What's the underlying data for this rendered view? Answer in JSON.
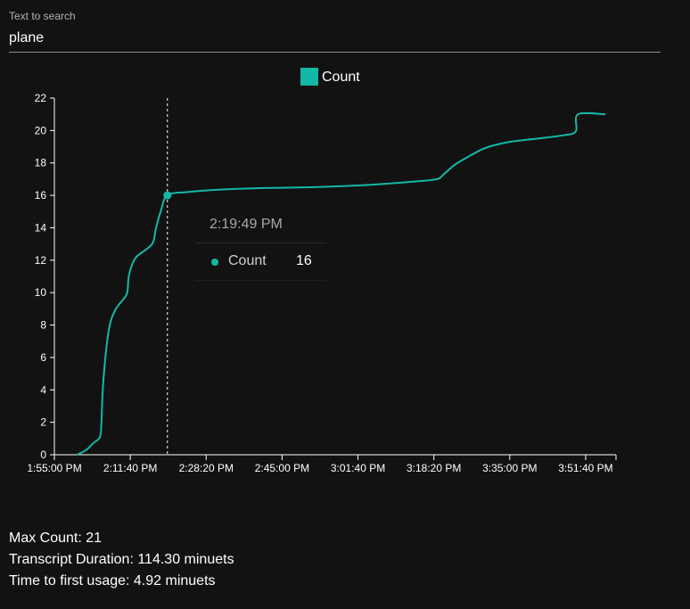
{
  "search": {
    "label": "Text to search",
    "value": "plane"
  },
  "colors": {
    "series": "#14b8a6",
    "background": "#121212",
    "text": "#ffffff",
    "muted": "#a8a8a8"
  },
  "tooltip": {
    "time": "2:19:49 PM",
    "series_name": "Count",
    "value": "16"
  },
  "stats": {
    "max_count": "Max Count: 21",
    "duration": "Transcript Duration: 114.30 minuets",
    "first_usage": "Time to first usage: 4.92 minuets"
  },
  "chart_data": {
    "type": "line",
    "legend": {
      "label": "Count",
      "position": "top-center"
    },
    "xlabel": "",
    "ylabel": "",
    "xlim": [
      "13:55:00",
      "15:58:20"
    ],
    "ylim": [
      0,
      22
    ],
    "y_ticks": [
      0,
      2,
      4,
      6,
      8,
      10,
      12,
      14,
      16,
      18,
      20,
      22
    ],
    "x_ticks": [
      "13:55:00",
      "14:11:40",
      "14:28:20",
      "14:45:00",
      "15:01:40",
      "15:18:20",
      "15:35:00",
      "15:51:40"
    ],
    "x_tick_labels": [
      "1:55:00 PM",
      "2:11:40 PM",
      "2:28:20 PM",
      "2:45:00 PM",
      "3:01:40 PM",
      "3:18:20 PM",
      "3:35:00 PM",
      "3:51:40 PM"
    ],
    "grid": false,
    "highlight": {
      "x": "14:19:49",
      "y": 16
    },
    "series": [
      {
        "name": "Count",
        "points": [
          [
            "14:00:00",
            0
          ],
          [
            "14:02:00",
            0.3
          ],
          [
            "14:03:30",
            0.7
          ],
          [
            "14:05:00",
            1.1
          ],
          [
            "14:05:20",
            2.0
          ],
          [
            "14:05:40",
            4.2
          ],
          [
            "14:06:30",
            6.8
          ],
          [
            "14:07:20",
            8.2
          ],
          [
            "14:08:30",
            9.0
          ],
          [
            "14:10:10",
            9.6
          ],
          [
            "14:11:00",
            10.0
          ],
          [
            "14:11:20",
            11.0
          ],
          [
            "14:12:10",
            11.8
          ],
          [
            "14:13:00",
            12.2
          ],
          [
            "14:14:20",
            12.5
          ],
          [
            "14:15:20",
            12.7
          ],
          [
            "14:16:40",
            13.1
          ],
          [
            "14:17:20",
            14.0
          ],
          [
            "14:18:20",
            15.0
          ],
          [
            "14:19:49",
            16.0
          ],
          [
            "14:24:00",
            16.2
          ],
          [
            "14:31:00",
            16.35
          ],
          [
            "14:41:00",
            16.45
          ],
          [
            "14:51:00",
            16.5
          ],
          [
            "15:01:00",
            16.6
          ],
          [
            "15:07:00",
            16.7
          ],
          [
            "15:14:00",
            16.85
          ],
          [
            "15:19:00",
            17.0
          ],
          [
            "15:20:30",
            17.3
          ],
          [
            "15:23:00",
            17.9
          ],
          [
            "15:26:00",
            18.4
          ],
          [
            "15:29:00",
            18.85
          ],
          [
            "15:31:40",
            19.1
          ],
          [
            "15:35:00",
            19.3
          ],
          [
            "15:41:00",
            19.5
          ],
          [
            "15:46:40",
            19.7
          ],
          [
            "15:49:30",
            19.95
          ],
          [
            "15:50:00",
            21.0
          ],
          [
            "15:56:00",
            21.0
          ]
        ]
      }
    ]
  }
}
